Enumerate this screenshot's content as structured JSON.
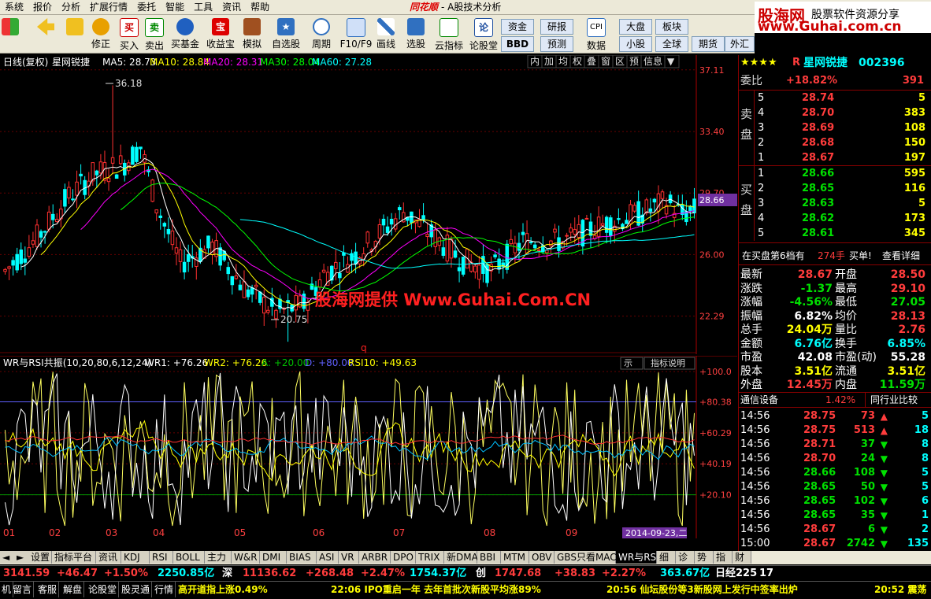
{
  "menu": [
    "系统",
    "报价",
    "分析",
    "扩展行情",
    "委托",
    "智能",
    "工具",
    "资讯",
    "帮助"
  ],
  "app_title": {
    "logo": "同花顺",
    "suffix": "- A股技术分析"
  },
  "brand": {
    "site": "股海网",
    "slogan": "股票软件资源分享",
    "url": "www.Guhai.com.cn"
  },
  "toolbar": {
    "buttons": [
      "",
      "",
      "修正",
      "买入",
      "卖出",
      "买基金",
      "收益宝",
      "模拟",
      "自选股",
      "周期",
      "F10/F9",
      "画线",
      "选股",
      "云指标",
      "论股堂",
      "数据"
    ],
    "small_left": [
      "资金",
      "研报",
      "BBD",
      "预测"
    ],
    "small_right": [
      "大盘",
      "板块",
      "小股",
      "全球",
      "期货",
      "外汇"
    ]
  },
  "chart_header": {
    "period": "日线(复权)",
    "name": "星网锐捷",
    "ma": [
      {
        "label": "MA5: 28.73",
        "color": "#ffffff"
      },
      {
        "label": "MA10: 28.84",
        "color": "#ffff00"
      },
      {
        "label": "MA20: 28.31",
        "color": "#ff00ff"
      },
      {
        "label": "MA30: 28.04",
        "color": "#00ff00"
      },
      {
        "label": "MA60: 27.28",
        "color": "#00ffff"
      }
    ],
    "buttons": [
      "内",
      "加",
      "均",
      "权",
      "叠",
      "窗",
      "区",
      "预",
      "信息",
      "▼"
    ]
  },
  "price_axis": [
    "37.11",
    "33.40",
    "29.70",
    "26.00",
    "22.29"
  ],
  "current_price_tag": "28.66",
  "annotations": {
    "high": "36.18",
    "low": "20.75",
    "watermark": "股海网提供 Www.Guhai.Com.CN",
    "q": "q"
  },
  "indicator_header": {
    "title": "WR与RSI共振(10,20,80,6,12,24)",
    "values": [
      {
        "label": "WR1: +76.26",
        "color": "#ffffff"
      },
      {
        "label": "WR2: +76.26",
        "color": "#ffff00"
      },
      {
        "label": "A: +20.00",
        "color": "#00c000"
      },
      {
        "label": "D: +80.00",
        "color": "#6060ff"
      },
      {
        "label": "RSI10: +49.63",
        "color": "#ffff00"
      }
    ],
    "btn1": "示",
    "btn2": "指标说明"
  },
  "ind_axis": [
    "+100.0",
    "+80.38",
    "+60.29",
    "+40.19",
    "+20.10"
  ],
  "months": [
    "01",
    "02",
    "03",
    "04",
    "05",
    "06",
    "07",
    "08",
    "09"
  ],
  "date_tag": "2014-09-23,二",
  "tabs": [
    "设置",
    "指标平台",
    "资讯",
    "KDJ",
    "RSI",
    "BOLL",
    "主力",
    "W&R",
    "DMI",
    "BIAS",
    "ASI",
    "VR",
    "ARBR",
    "DPO",
    "TRIX",
    "新DMA",
    "BBI",
    "MTM",
    "OBV",
    "GBS只看MACD",
    "WR与RSI",
    "细",
    "诊",
    "势",
    "指",
    "财"
  ],
  "quote_bar": [
    {
      "t": "3141.59",
      "c": "red"
    },
    {
      "t": "+46.47",
      "c": "red"
    },
    {
      "t": "+1.50%",
      "c": "red"
    },
    {
      "t": "2250.85亿",
      "c": "cyan"
    },
    {
      "t": "深",
      "c": "white"
    },
    {
      "t": "11136.62",
      "c": "red"
    },
    {
      "t": "+268.48",
      "c": "red"
    },
    {
      "t": "+2.47%",
      "c": "red"
    },
    {
      "t": "1754.37亿",
      "c": "cyan"
    },
    {
      "t": "创",
      "c": "white"
    },
    {
      "t": "1747.68",
      "c": "red"
    },
    {
      "t": "+38.83",
      "c": "red"
    },
    {
      "t": "+2.27%",
      "c": "red"
    },
    {
      "t": "363.67亿",
      "c": "cyan"
    },
    {
      "t": "日经225",
      "c": "white"
    },
    {
      "t": "17",
      "c": "white"
    }
  ],
  "news_bar": [
    "机",
    "留言",
    "客服",
    "解盘",
    "论股堂",
    "股灵通",
    "行情",
    "高开道指上涨0.49%",
    "22:06 IPO重启一年 去年首批次新股平均涨89%",
    "20:56 仙坛股份等3新股网上发行中签率出炉",
    "20:52 震荡"
  ],
  "stock": {
    "stars": "★★★★",
    "prefix": "R",
    "name": "星网锐捷",
    "code": "002396",
    "weibi_label": "委比",
    "weibi": "+18.82%",
    "weicha": "391",
    "sell_label": "卖盘",
    "buy_label": "买盘",
    "sell": [
      {
        "lv": "5",
        "p": "28.74",
        "v": "5"
      },
      {
        "lv": "4",
        "p": "28.70",
        "v": "383"
      },
      {
        "lv": "3",
        "p": "28.69",
        "v": "108"
      },
      {
        "lv": "2",
        "p": "28.68",
        "v": "150"
      },
      {
        "lv": "1",
        "p": "28.67",
        "v": "197"
      }
    ],
    "buy": [
      {
        "lv": "1",
        "p": "28.66",
        "v": "595"
      },
      {
        "lv": "2",
        "p": "28.65",
        "v": "116"
      },
      {
        "lv": "3",
        "p": "28.63",
        "v": "5"
      },
      {
        "lv": "4",
        "p": "28.62",
        "v": "173"
      },
      {
        "lv": "5",
        "p": "28.61",
        "v": "345"
      }
    ],
    "order_info": {
      "text": "在买盘第6档有",
      "qty": "274手",
      "act": "买单!",
      "link": "查看详细"
    },
    "stats": [
      {
        "l1": "最新",
        "v1": "28.67",
        "c1": "red",
        "l2": "开盘",
        "v2": "28.50",
        "c2": "red"
      },
      {
        "l1": "涨跌",
        "v1": "-1.37",
        "c1": "green",
        "l2": "最高",
        "v2": "29.10",
        "c2": "red"
      },
      {
        "l1": "涨幅",
        "v1": "-4.56%",
        "c1": "green",
        "l2": "最低",
        "v2": "27.05",
        "c2": "green"
      },
      {
        "l1": "振幅",
        "v1": "6.82%",
        "c1": "white",
        "l2": "均价",
        "v2": "28.13",
        "c2": "red"
      },
      {
        "l1": "总手",
        "v1": "24.04万",
        "c1": "yellow",
        "l2": "量比",
        "v2": "2.76",
        "c2": "red"
      },
      {
        "l1": "金额",
        "v1": "6.76亿",
        "c1": "cyan",
        "l2": "换手",
        "v2": "6.85%",
        "c2": "cyan"
      },
      {
        "l1": "市盈",
        "v1": "42.08",
        "c1": "white",
        "l2": "市盈(动)",
        "v2": "55.28",
        "c2": "white"
      },
      {
        "l1": "股本",
        "v1": "3.51亿",
        "c1": "yellow",
        "l2": "流通",
        "v2": "3.51亿",
        "c2": "yellow"
      },
      {
        "l1": "外盘",
        "v1": "12.45万",
        "c1": "red",
        "l2": "内盘",
        "v2": "11.59万",
        "c2": "green"
      }
    ],
    "industry": {
      "name": "通信设备",
      "pct": "1.42%",
      "btn": "同行业比较"
    },
    "ticks": [
      {
        "t": "14:56",
        "p": "28.75",
        "pc": "red",
        "v": "73",
        "dir": "up",
        "n": "5"
      },
      {
        "t": "14:56",
        "p": "28.75",
        "pc": "red",
        "v": "513",
        "dir": "up",
        "n": "18"
      },
      {
        "t": "14:56",
        "p": "28.71",
        "pc": "red",
        "v": "37",
        "dir": "down",
        "n": "8"
      },
      {
        "t": "14:56",
        "p": "28.70",
        "pc": "red",
        "v": "24",
        "dir": "down",
        "n": "8"
      },
      {
        "t": "14:56",
        "p": "28.66",
        "pc": "green",
        "v": "108",
        "dir": "down",
        "n": "5"
      },
      {
        "t": "14:56",
        "p": "28.65",
        "pc": "green",
        "v": "50",
        "dir": "down",
        "n": "5"
      },
      {
        "t": "14:56",
        "p": "28.65",
        "pc": "green",
        "v": "102",
        "dir": "down",
        "n": "6"
      },
      {
        "t": "14:56",
        "p": "28.65",
        "pc": "green",
        "v": "35",
        "dir": "down",
        "n": "1"
      },
      {
        "t": "14:56",
        "p": "28.67",
        "pc": "red",
        "v": "6",
        "dir": "down",
        "n": "2"
      },
      {
        "t": "15:00",
        "p": "28.67",
        "pc": "red",
        "v": "2742",
        "dir": "down",
        "n": "135"
      }
    ]
  },
  "chart_data": {
    "type": "candlestick",
    "x": [
      "01",
      "02",
      "03",
      "04",
      "05",
      "06",
      "07",
      "08",
      "09"
    ],
    "ylim": [
      20.0,
      38.0
    ],
    "close_by_month": [
      27.0,
      29.5,
      32.0,
      25.5,
      22.5,
      26.0,
      28.5,
      26.5,
      28.67
    ],
    "high": 36.18,
    "low": 20.75,
    "last": 28.66,
    "indicator": {
      "name": "WR与RSI共振",
      "ylim": [
        0,
        100
      ],
      "lines": [
        80.38,
        20.1
      ]
    }
  }
}
